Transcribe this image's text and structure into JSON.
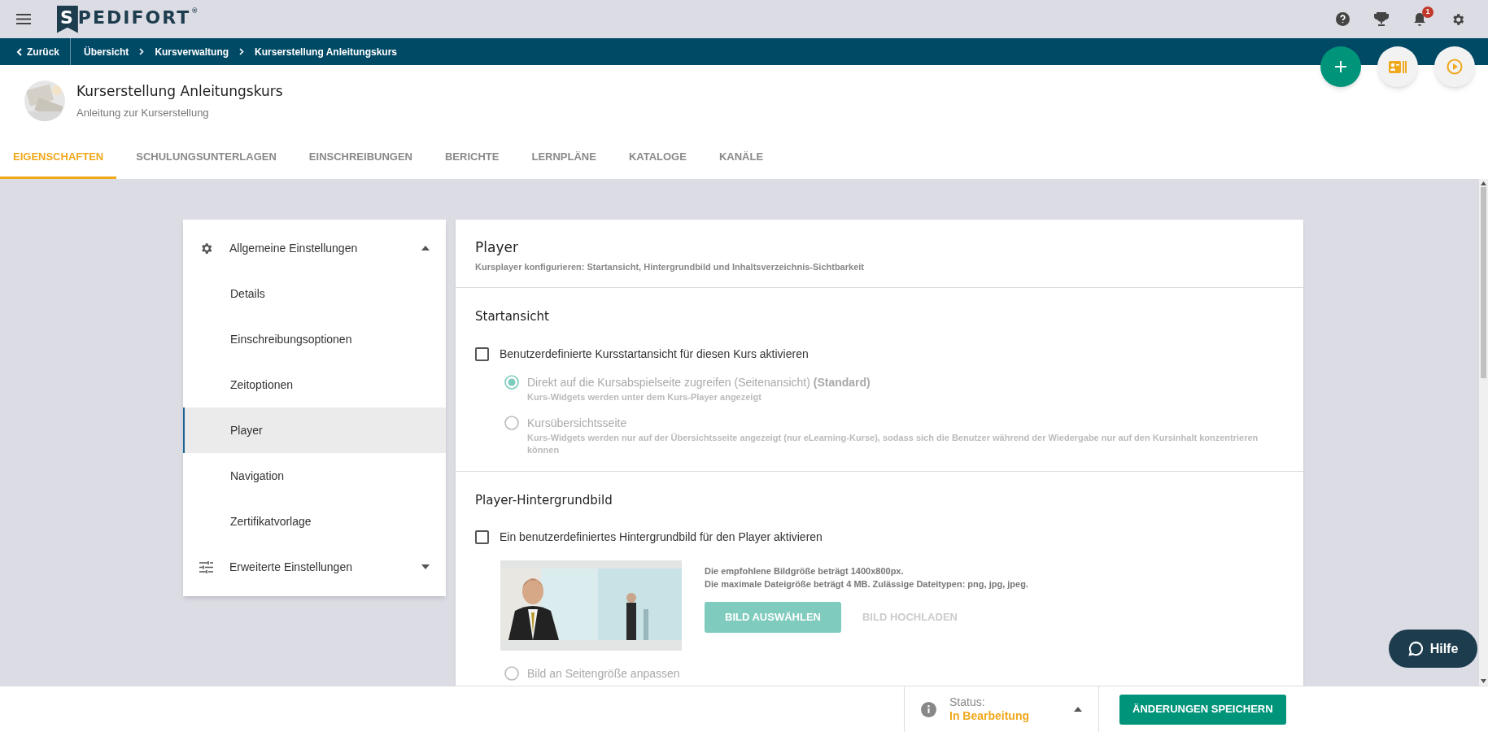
{
  "top_bar": {
    "logo": "SPEDIFORT",
    "logo_mark": "®",
    "notification_count": "1"
  },
  "breadcrumb": {
    "back": "Zurück",
    "items": [
      "Übersicht",
      "Kursverwaltung",
      "Kurserstellung Anleitungskurs"
    ]
  },
  "course": {
    "title": "Kurserstellung Anleitungskurs",
    "subtitle": "Anleitung zur Kurserstellung"
  },
  "tabs": [
    {
      "label": "EIGENSCHAFTEN",
      "selected": true
    },
    {
      "label": "SCHULUNGSUNTERLAGEN",
      "selected": false
    },
    {
      "label": "EINSCHREIBUNGEN",
      "selected": false
    },
    {
      "label": "BERICHTE",
      "selected": false
    },
    {
      "label": "LERNPLÄNE",
      "selected": false
    },
    {
      "label": "KATALOGE",
      "selected": false
    },
    {
      "label": "KANÄLE",
      "selected": false
    }
  ],
  "sidebar": {
    "groups": [
      {
        "label": "Allgemeine Einstellungen",
        "expanded": true,
        "children": [
          {
            "label": "Details",
            "selected": false
          },
          {
            "label": "Einschreibungsoptionen",
            "selected": false
          },
          {
            "label": "Zeitoptionen",
            "selected": false
          },
          {
            "label": "Player",
            "selected": true
          },
          {
            "label": "Navigation",
            "selected": false
          },
          {
            "label": "Zertifikatvorlage",
            "selected": false
          }
        ]
      },
      {
        "label": "Erweiterte Einstellungen",
        "expanded": false
      }
    ]
  },
  "panel": {
    "title": "Player",
    "subtitle": "Kursplayer konfigurieren: Startansicht, Hintergrundbild und Inhaltsverzeichnis-Sichtbarkeit",
    "sections": [
      {
        "title": "Startansicht",
        "checkbox": {
          "label": "Benutzerdefinierte Kursstartansicht für diesen Kurs aktivieren",
          "checked": false
        },
        "options": [
          {
            "label": "Direkt auf die Kursabspielseite zugreifen (Seitenansicht) **(Standard)**",
            "hint": "Kurs-Widgets werden unter dem Kurs-Player angezeigt",
            "selected": true,
            "disabled": true
          },
          {
            "label": "Kursübersichtsseite",
            "hint": "Kurs-Widgets werden nur auf der Übersichtsseite angezeigt (nur eLearning-Kurse), sodass sich die Benutzer während der Wiedergabe nur auf den Kursinhalt konzentrieren können",
            "selected": false,
            "disabled": true
          }
        ]
      },
      {
        "title": "Player-Hintergrundbild",
        "checkbox": {
          "label": "Ein benutzerdefiniertes Hintergrundbild für den Player aktivieren",
          "checked": false
        },
        "image": {
          "kind": "picture"
        },
        "info": [
          "Die empfohlene Bildgröße beträgt 1400x800px.",
          "Die maximale Dateigröße beträgt 4 MB. Zulässige Dateitypen: png, jpg, jpeg."
        ],
        "buttons": [
          {
            "label": "BILD AUSWÄHLEN",
            "kind": "primary"
          },
          {
            "label": "BILD HOCHLADEN",
            "kind": "text"
          }
        ],
        "options": [
          {
            "label": "Bild an Seitengröße anpassen",
            "selected": false,
            "disabled": true
          }
        ]
      }
    ]
  },
  "status": {
    "label": "Status:",
    "value": "In Bearbeitung"
  },
  "save_button": "ÄNDERUNGEN SPEICHERN",
  "help_button": "Hilfe"
}
